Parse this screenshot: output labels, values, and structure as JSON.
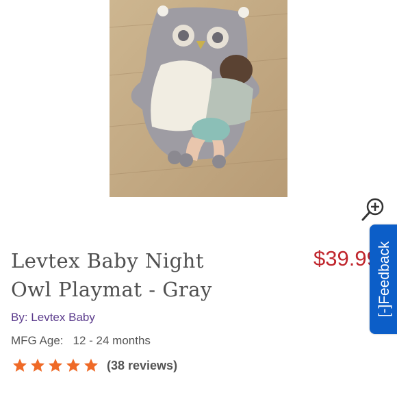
{
  "product": {
    "title_line1": "Levtex Baby Night",
    "title_line2": "Owl Playmat - Gray",
    "price": "$39.99",
    "brand_prefix": "By:",
    "brand_name": "Levtex Baby",
    "mfg_age_label": "MFG Age:",
    "mfg_age_value": "12 - 24 months",
    "rating": 5,
    "rating_max": 5,
    "reviews_label": "(38 reviews)"
  },
  "feedback_tab": {
    "label": "[-]Feedback"
  },
  "icons": {
    "zoom": "zoom-in-icon",
    "star": "star-icon"
  },
  "colors": {
    "price": "#c0262d",
    "brand_link": "#5b3b8c",
    "star": "#ef6a27",
    "feedback_bg": "#0c5ec8"
  }
}
